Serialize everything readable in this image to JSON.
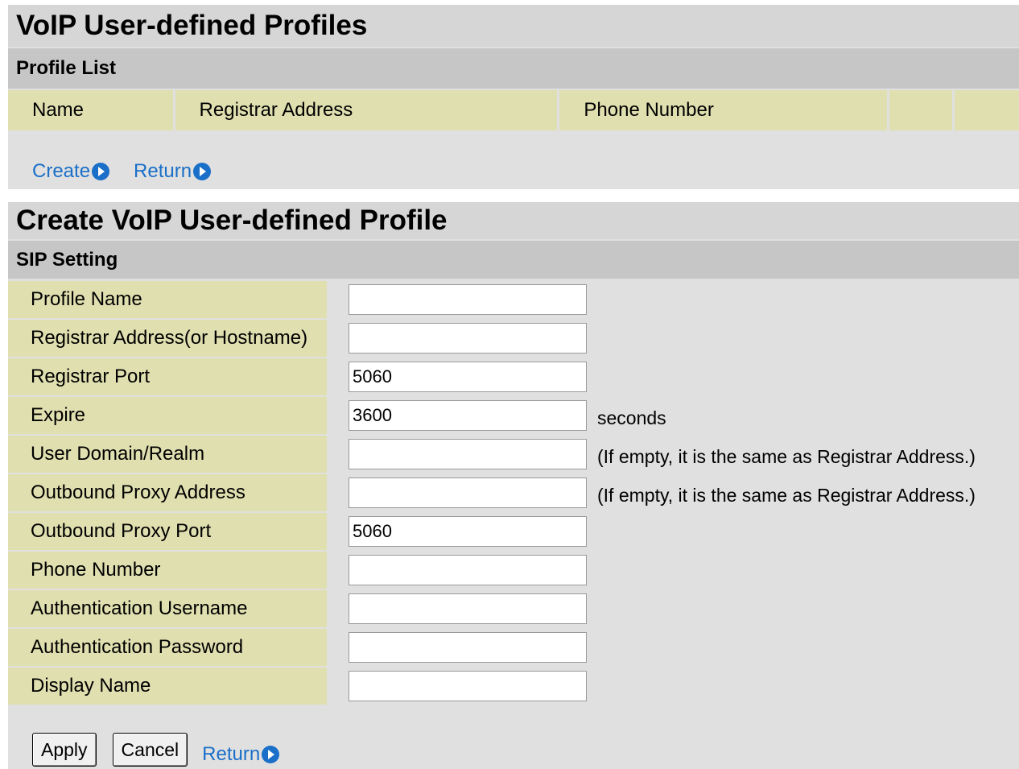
{
  "list_panel": {
    "title": "VoIP User-defined Profiles",
    "section": "Profile List",
    "columns": [
      "Name",
      "Registrar Address",
      "Phone Number",
      "",
      ""
    ],
    "create_link": "Create",
    "return_link": "Return"
  },
  "create_panel": {
    "title": "Create VoIP User-defined Profile",
    "section": "SIP Setting",
    "fields": [
      {
        "label": "Profile Name",
        "value": "",
        "note": ""
      },
      {
        "label": "Registrar Address(or Hostname)",
        "value": "",
        "note": ""
      },
      {
        "label": "Registrar Port",
        "value": "5060",
        "note": ""
      },
      {
        "label": "Expire",
        "value": "3600",
        "note": "seconds"
      },
      {
        "label": "User Domain/Realm",
        "value": "",
        "note": "(If empty, it is the same as Registrar Address.)"
      },
      {
        "label": "Outbound Proxy Address",
        "value": "",
        "note": "(If empty, it is the same as Registrar Address.)"
      },
      {
        "label": "Outbound Proxy Port",
        "value": "5060",
        "note": ""
      },
      {
        "label": "Phone Number",
        "value": "",
        "note": ""
      },
      {
        "label": "Authentication Username",
        "value": "",
        "note": ""
      },
      {
        "label": "Authentication Password",
        "value": "",
        "note": ""
      },
      {
        "label": "Display Name",
        "value": "",
        "note": ""
      }
    ],
    "apply_label": "Apply",
    "cancel_label": "Cancel",
    "return_link": "Return"
  },
  "colors": {
    "link": "#1a6fc8",
    "label_bg": "#e0dfb0",
    "title_bg": "#d6d6d6",
    "section_bg": "#c6c6c6"
  }
}
